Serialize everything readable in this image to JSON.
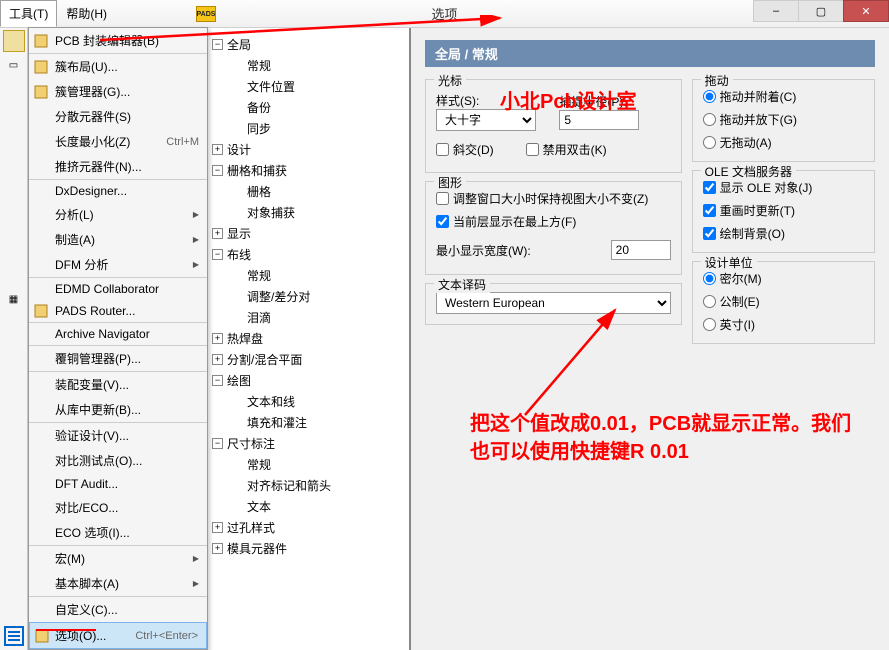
{
  "titlebar": {
    "title": "选项",
    "menu_tools": "工具(T)",
    "menu_help": "帮助(H)"
  },
  "win": {
    "min": "–",
    "max": "▢",
    "close": "✕"
  },
  "menu": {
    "items": [
      {
        "label": "PCB 封装编辑器(B)",
        "icon": true
      },
      {
        "label": "簇布局(U)...",
        "sep": true,
        "icon": true
      },
      {
        "label": "簇管理器(G)...",
        "icon": true
      },
      {
        "label": "分散元器件(S)"
      },
      {
        "label": "长度最小化(Z)",
        "shortcut": "Ctrl+M"
      },
      {
        "label": "推挤元器件(N)..."
      },
      {
        "label": "DxDesigner...",
        "sep": true
      },
      {
        "label": "分析(L)",
        "arrow": true
      },
      {
        "label": "制造(A)",
        "arrow": true
      },
      {
        "label": "DFM 分析",
        "arrow": true
      },
      {
        "label": "EDMD Collaborator",
        "sep": true
      },
      {
        "label": "PADS Router...",
        "icon": true
      },
      {
        "label": "Archive Navigator",
        "sep": true
      },
      {
        "label": "覆铜管理器(P)...",
        "sep": true
      },
      {
        "label": "装配变量(V)...",
        "sep": true
      },
      {
        "label": "从库中更新(B)..."
      },
      {
        "label": "验证设计(V)...",
        "sep": true
      },
      {
        "label": "对比测试点(O)..."
      },
      {
        "label": "DFT Audit..."
      },
      {
        "label": "对比/ECO..."
      },
      {
        "label": "ECO 选项(I)..."
      },
      {
        "label": "宏(M)",
        "arrow": true,
        "sep": true
      },
      {
        "label": "基本脚本(A)",
        "arrow": true
      },
      {
        "label": "自定义(C)...",
        "sep": true
      },
      {
        "label": "选项(O)...",
        "shortcut": "Ctrl+<Enter>",
        "highlight": true,
        "icon": true
      }
    ]
  },
  "tree": {
    "nodes": [
      {
        "label": "全局",
        "expanded": true,
        "children": [
          "常规",
          "文件位置",
          "备份",
          "同步"
        ]
      },
      {
        "label": "设计",
        "expanded": false
      },
      {
        "label": "栅格和捕获",
        "expanded": true,
        "children": [
          "栅格",
          "对象捕获"
        ]
      },
      {
        "label": "显示",
        "expanded": false
      },
      {
        "label": "布线",
        "expanded": true,
        "children": [
          "常规",
          "调整/差分对",
          "泪滴"
        ]
      },
      {
        "label": "热焊盘",
        "expanded": false
      },
      {
        "label": "分割/混合平面",
        "expanded": false
      },
      {
        "label": "绘图",
        "expanded": true,
        "children": [
          "文本和线",
          "填充和灌注"
        ]
      },
      {
        "label": "尺寸标注",
        "expanded": true,
        "children": [
          "常规",
          "对齐标记和箭头",
          "文本"
        ]
      },
      {
        "label": "过孔样式",
        "expanded": false
      },
      {
        "label": "模具元器件",
        "expanded": false
      }
    ]
  },
  "dialog": {
    "section": "全局 / 常规",
    "cursor_group": "光标",
    "style_label": "样式(S):",
    "style_value": "大十字",
    "radius_label": "捕捉半径(P):",
    "radius_value": "5",
    "diag_label": "斜交(D)",
    "dbl_label": "禁用双击(K)",
    "graphics_group": "图形",
    "keep_view_label": "调整窗口大小时保持视图大小不变(Z)",
    "top_layer_label": "当前层显示在最上方(F)",
    "min_width_label": "最小显示宽度(W):",
    "min_width_value": "20",
    "text_group": "文本译码",
    "encoding_value": "Western European",
    "drag_group": "拖动",
    "drag_attach": "拖动并附着(C)",
    "drag_drop": "拖动并放下(G)",
    "no_drag": "无拖动(A)",
    "ole_group": "OLE 文档服务器",
    "show_ole": "显示 OLE 对象(J)",
    "redraw_ole": "重画时更新(T)",
    "draw_bg": "绘制背景(O)",
    "unit_group": "设计单位",
    "unit_mil": "密尔(M)",
    "unit_mm": "公制(E)",
    "unit_inch": "英寸(I)"
  },
  "annotations": {
    "brand": "小北Pcb设计室",
    "note": "把这个值改成0.01，PCB就显示正常。我们也可以使用快捷键R 0.01"
  },
  "pads_icon": "PADS"
}
